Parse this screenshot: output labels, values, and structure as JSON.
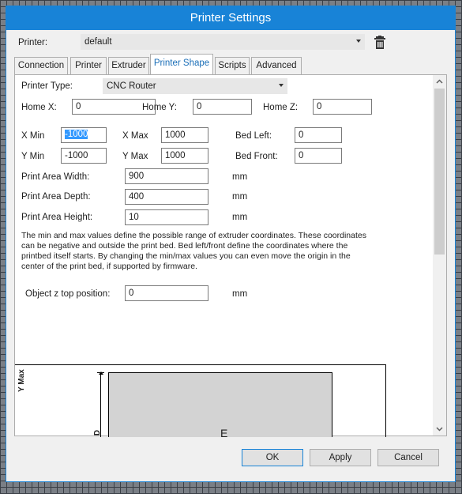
{
  "window": {
    "title": "Printer Settings"
  },
  "printer": {
    "label": "Printer:",
    "value": "default"
  },
  "tabs": [
    {
      "label": "Connection"
    },
    {
      "label": "Printer"
    },
    {
      "label": "Extruder"
    },
    {
      "label": "Printer Shape"
    },
    {
      "label": "Scripts"
    },
    {
      "label": "Advanced"
    }
  ],
  "active_tab": "Printer Shape",
  "shape": {
    "printer_type_label": "Printer Type:",
    "printer_type_value": "CNC Router",
    "home_x_label": "Home X:",
    "home_x": "0",
    "home_y_label": "Home Y:",
    "home_y": "0",
    "home_z_label": "Home Z:",
    "home_z": "0",
    "xmin_label": "X Min",
    "xmin": "-1000",
    "xmax_label": "X Max",
    "xmax": "1000",
    "ymin_label": "Y Min",
    "ymin": "-1000",
    "ymax_label": "Y Max",
    "ymax": "1000",
    "bed_left_label": "Bed Left:",
    "bed_left": "0",
    "bed_front_label": "Bed Front:",
    "bed_front": "0",
    "width_label": "Print Area Width:",
    "width": "900",
    "width_unit": "mm",
    "depth_label": "Print Area Depth:",
    "depth": "400",
    "depth_unit": "mm",
    "height_label": "Print Area Height:",
    "height": "10",
    "height_unit": "mm",
    "help_lines": [
      "The min and max values define the possible range of extruder coordinates. These coordinates",
      "can be negative and outside the print bed. Bed left/front define the coordinates where the",
      "printbed itself starts. By changing the min/max values you can even move the origin in the",
      "center of the print bed, if supported by firmware."
    ],
    "ztop_label": "Object z top position:",
    "ztop": "0",
    "ztop_unit": "mm"
  },
  "diagram": {
    "y_axis_label": "Y Max",
    "glyph_d": "D",
    "glyph_e": "E"
  },
  "buttons": {
    "ok": "OK",
    "apply": "Apply",
    "cancel": "Cancel"
  },
  "icons": {
    "trash": "trash-icon",
    "dropdown": "chevron-down-icon",
    "scroll_up": "scroll-up-icon",
    "scroll_down": "scroll-down-icon"
  },
  "colors": {
    "accent": "#1883d7",
    "active_tab_text": "#1b6fb8",
    "selection": "#3399ff"
  }
}
